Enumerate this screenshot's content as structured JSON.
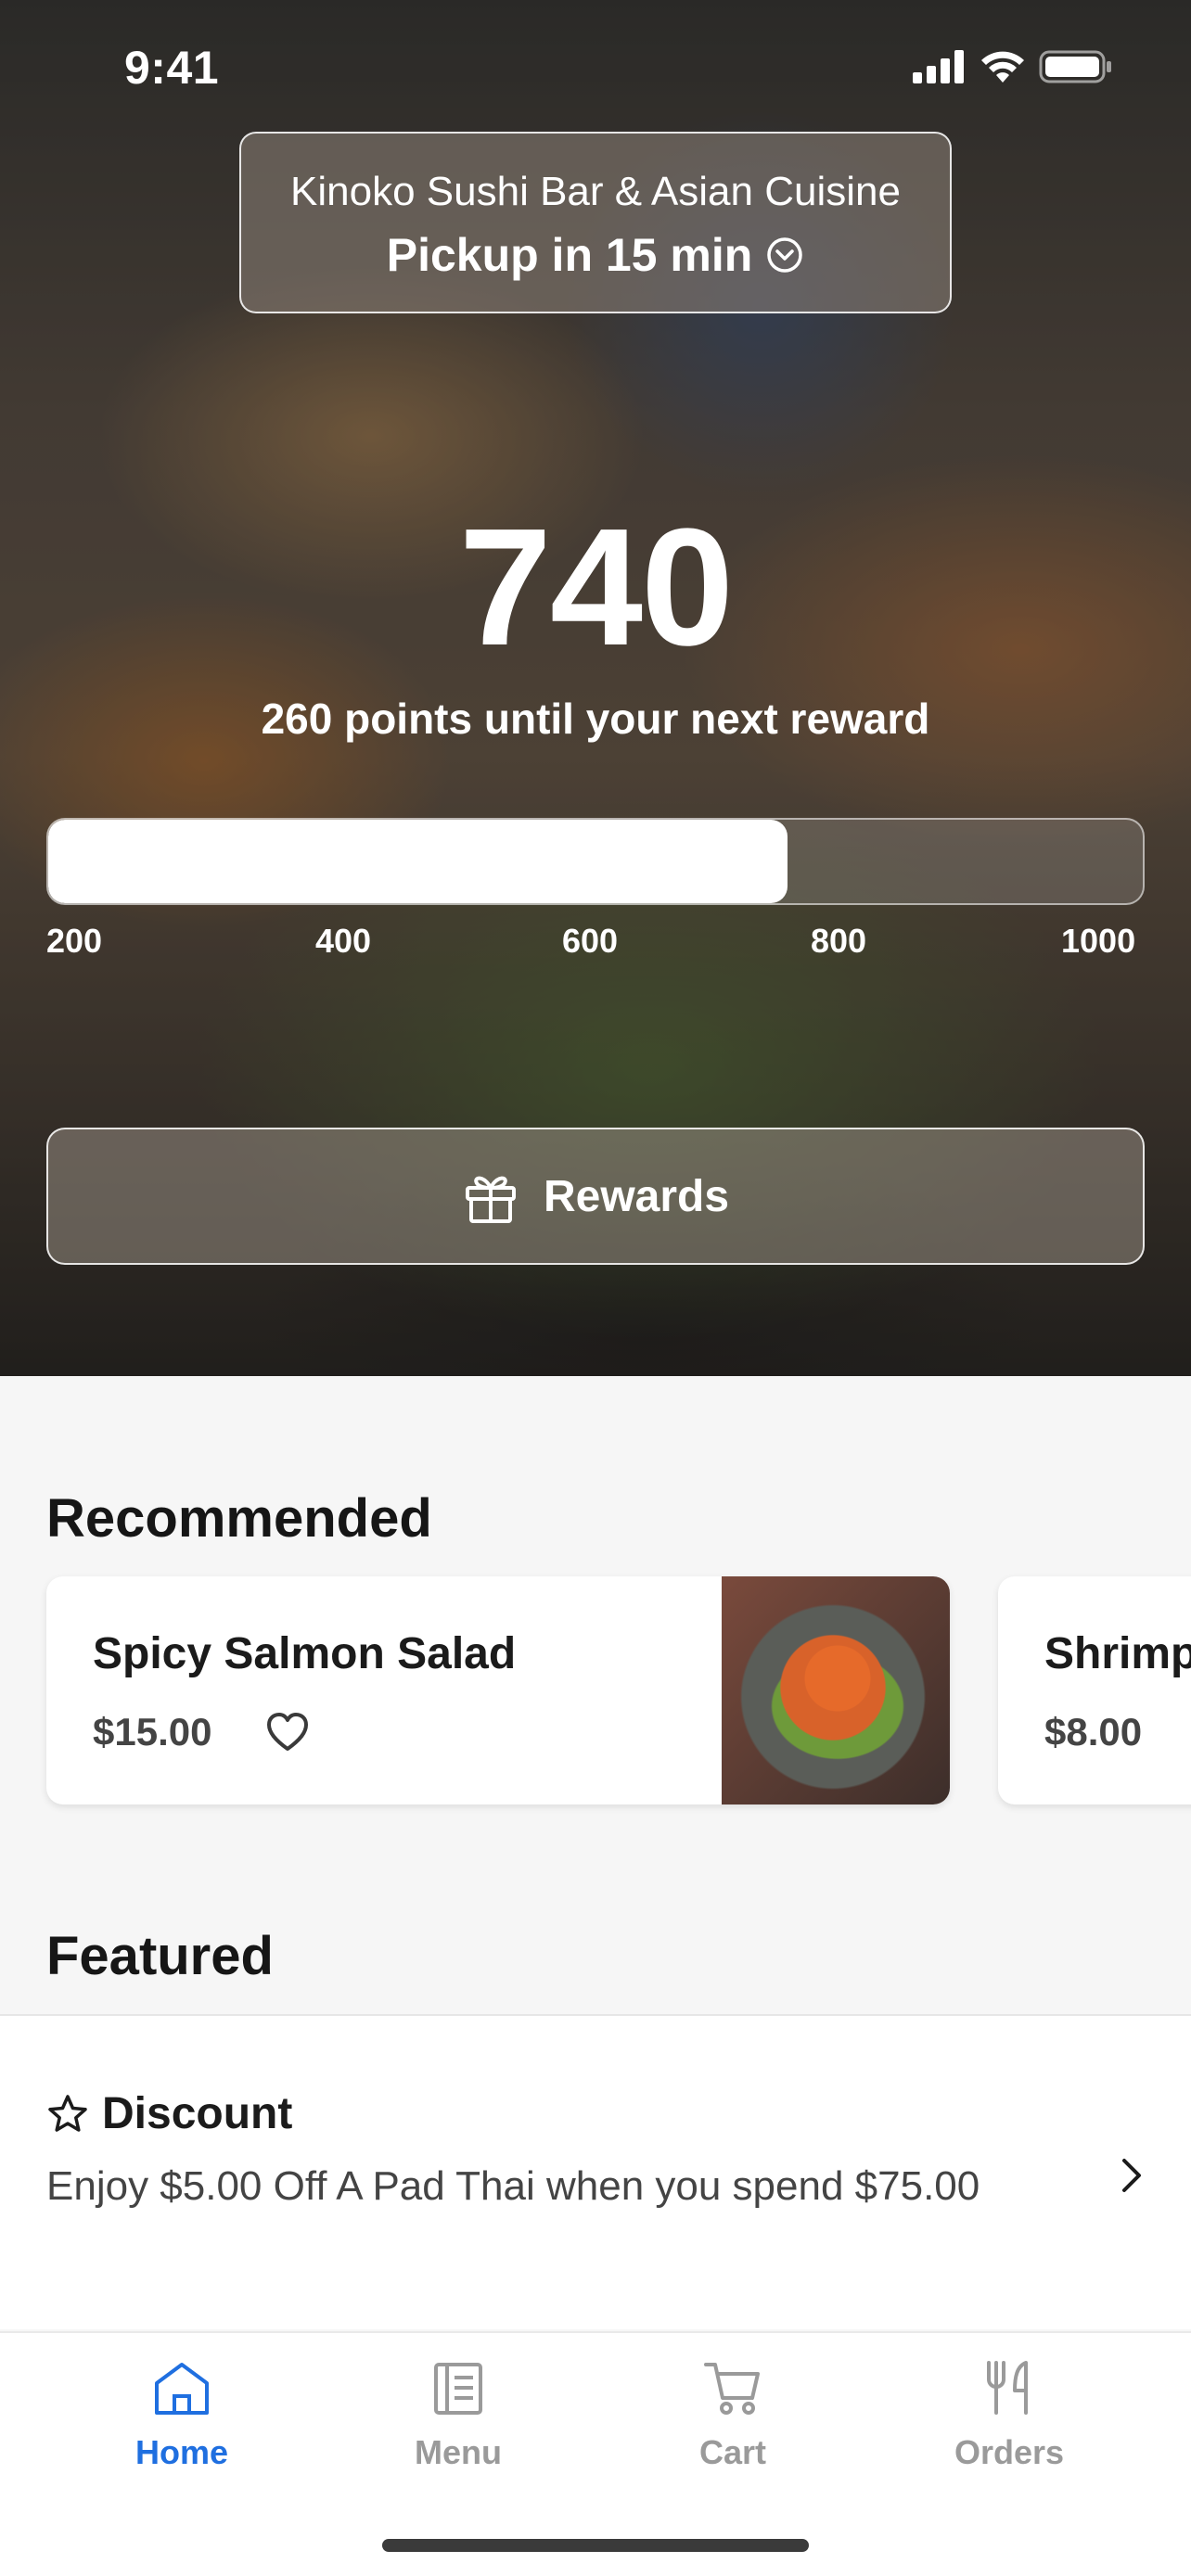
{
  "status_bar": {
    "time": "9:41"
  },
  "store": {
    "name": "Kinoko Sushi Bar & Asian Cuisine",
    "pickup": "Pickup in 15 min"
  },
  "loyalty": {
    "points": "740",
    "subtitle": "260 points until your next reward",
    "progress": {
      "min": 200,
      "max": 1000,
      "value": 740,
      "ticks": [
        "200",
        "400",
        "600",
        "800",
        "1000"
      ]
    },
    "rewards_label": "Rewards"
  },
  "recommended": {
    "title": "Recommended",
    "items": [
      {
        "name": "Spicy Salmon Salad",
        "price": "$15.00"
      },
      {
        "name": "Shrimp",
        "price": "$8.00"
      }
    ]
  },
  "featured": {
    "title": "Featured",
    "items": [
      {
        "label": "Discount",
        "description": "Enjoy $5.00 Off A Pad Thai when you spend $75.00"
      }
    ]
  },
  "tabbar": {
    "active": "home",
    "tabs": [
      {
        "id": "home",
        "label": "Home",
        "icon": "home-icon"
      },
      {
        "id": "menu",
        "label": "Menu",
        "icon": "menu-icon"
      },
      {
        "id": "cart",
        "label": "Cart",
        "icon": "cart-icon"
      },
      {
        "id": "orders",
        "label": "Orders",
        "icon": "fork-knife-icon"
      }
    ]
  },
  "colors": {
    "accent": "#1f6fe0",
    "inactive_tab": "#9a9a9a"
  }
}
